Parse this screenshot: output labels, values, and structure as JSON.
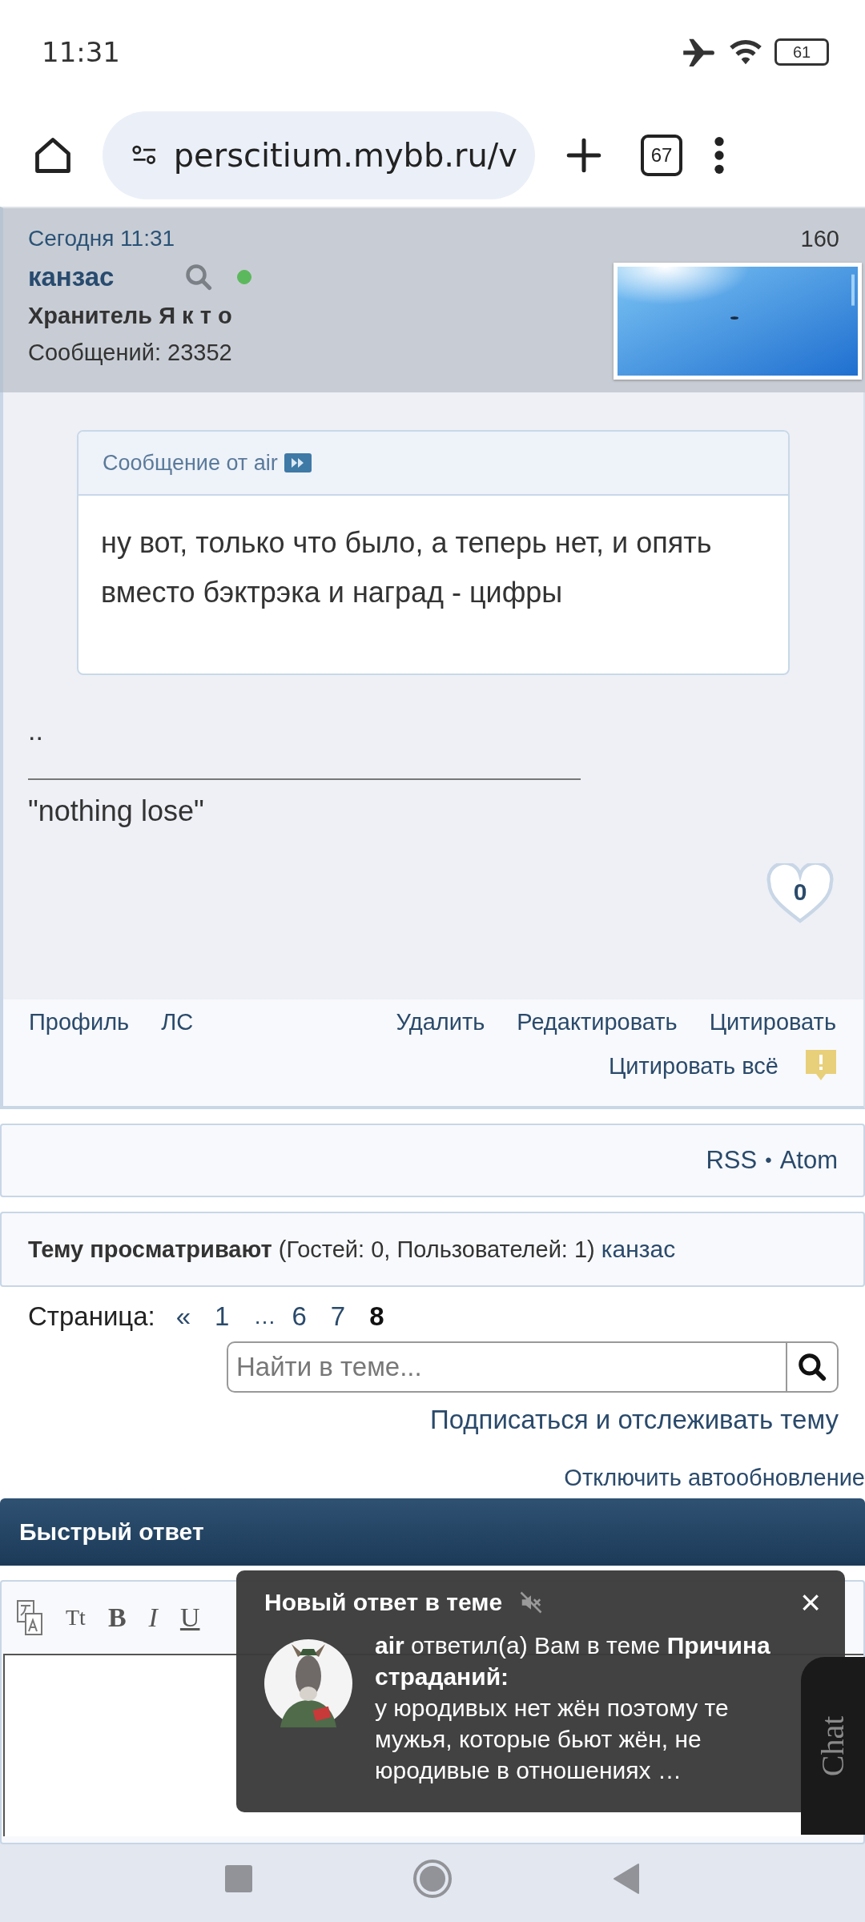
{
  "status_bar": {
    "time": "11:31",
    "battery": "61"
  },
  "browser": {
    "url": "perscitium.mybb.ru/v",
    "tab_count": "67"
  },
  "post": {
    "date": "Сегодня 11:31",
    "number": "160",
    "author": "канзас",
    "online": true,
    "rank": "Хранитель Я к т о",
    "posts": "Сообщений: 23352",
    "quote": {
      "header": "Сообщение от air",
      "text": "ну вот, только что было, а теперь нет, и опять вместо бэктрэка и наград - цифры"
    },
    "body": "..",
    "signature": "\"nothing lose\"",
    "likes": "0",
    "links_left": [
      "Профиль",
      "ЛС"
    ],
    "links_right": [
      "Удалить",
      "Редактировать",
      "Цитировать"
    ],
    "quote_all": "Цитировать всё"
  },
  "feeds": {
    "rss": "RSS",
    "separator": "•",
    "atom": "Atom"
  },
  "viewers": {
    "label": "Тему просматривают",
    "counts": "(Гостей: 0, Пользователей: 1)",
    "user": "канзас"
  },
  "pagination": {
    "label": "Страница:",
    "pages": [
      {
        "text": "«",
        "kind": "link",
        "selected": false
      },
      {
        "text": "1",
        "kind": "link",
        "selected": false
      },
      {
        "text": "…",
        "kind": "gap"
      },
      {
        "text": "6",
        "kind": "link",
        "selected": false
      },
      {
        "text": "7",
        "kind": "link",
        "selected": false
      },
      {
        "text": "8",
        "kind": "link",
        "selected": true
      }
    ]
  },
  "search": {
    "placeholder": "Найти в теме..."
  },
  "subscribe": "Подписаться и отслеживать тему",
  "autoupdate": "Отключить автообновление",
  "quick_reply": {
    "title": "Быстрый ответ",
    "toolbar": [
      {
        "kind": "translate"
      },
      {
        "kind": "size",
        "label": "Tt"
      },
      {
        "kind": "bold",
        "label": "B"
      },
      {
        "kind": "italic",
        "label": "I"
      },
      {
        "kind": "underline",
        "label": "U"
      }
    ]
  },
  "notification": {
    "title": "Новый ответ в теме",
    "muted": true,
    "close": "×",
    "text": "**air** ответил(а) Вам в теме **Причина страданий:**",
    "excerpt": "у юродивых нет жён поэтому те мужья, которые бьют жён, не юродивые в отношениях …"
  },
  "chat": "Chat"
}
